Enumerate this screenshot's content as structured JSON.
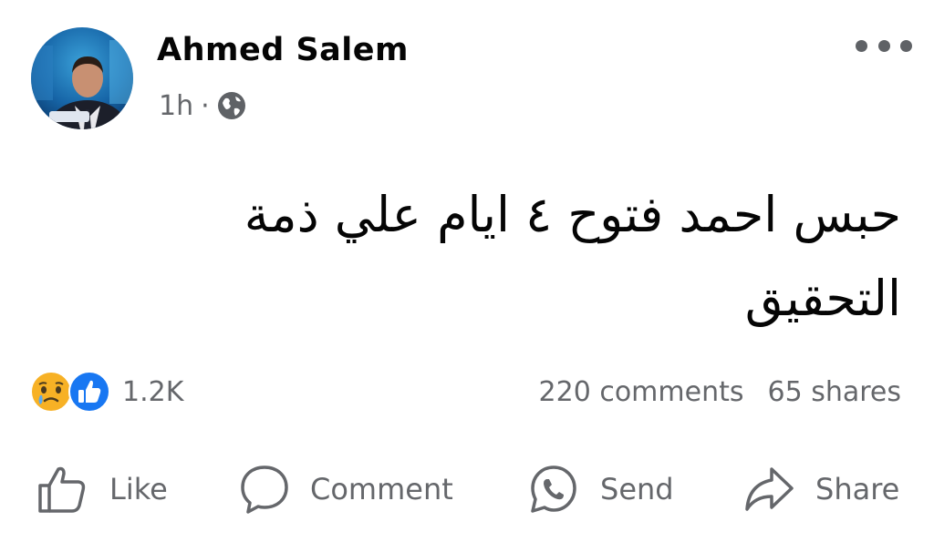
{
  "post": {
    "author": "Ahmed Salem",
    "time": "1h",
    "separator": "·",
    "privacy_icon": "globe-icon",
    "more_icon": "more-horizontal-icon",
    "text": "حبس احمد فتوح ٤ ايام علي ذمة التحقيق"
  },
  "reactions": {
    "icons": [
      "sad-reaction-icon",
      "like-reaction-icon"
    ],
    "count": "1.2K"
  },
  "stats": {
    "comments": "220 comments",
    "shares": "65 shares"
  },
  "actions": {
    "like_label": "Like",
    "comment_label": "Comment",
    "send_label": "Send",
    "share_label": "Share"
  },
  "colors": {
    "text_primary": "#050505",
    "text_secondary": "#65676b",
    "like_blue": "#1877f2",
    "sad_yellow": "#f7b125"
  }
}
